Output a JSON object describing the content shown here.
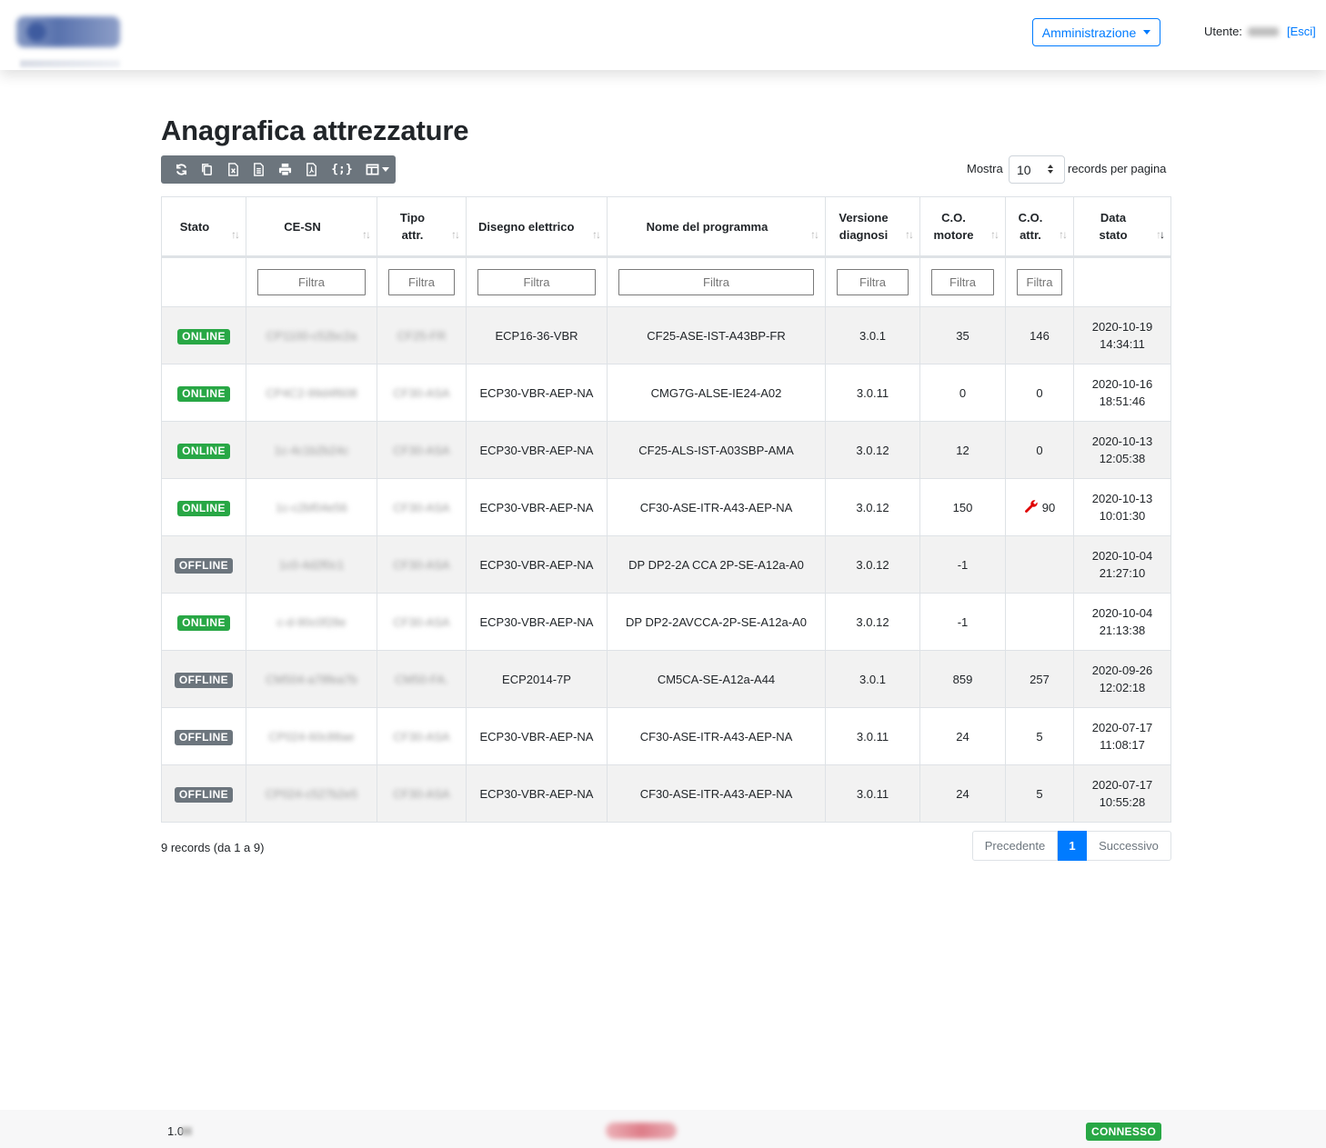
{
  "header": {
    "admin_menu": "Amministrazione",
    "user_label": "Utente:",
    "logout": "[Esci]"
  },
  "page": {
    "title": "Anagrafica attrezzature"
  },
  "toolbar": {
    "icons": [
      "refresh-icon",
      "copy-icon",
      "excel-icon",
      "csv-icon",
      "print-icon",
      "pdf-icon",
      "json-icon",
      "columns-icon"
    ],
    "json_label": "{;}"
  },
  "length": {
    "label_before": "Mostra",
    "value": "10",
    "label_after": "records per pagina"
  },
  "table": {
    "columns": [
      "Stato",
      "CE-SN",
      "Tipo attr.",
      "Disegno elettrico",
      "Nome del programma",
      "Versione diagnosi",
      "C.O. motore",
      "C.O. attr.",
      "Data stato"
    ],
    "filter_placeholder": "Filtra",
    "rows": [
      {
        "stato": "ONLINE",
        "cesn": "CP1100-c52bc2a",
        "tipo": "CF25-FR",
        "disegno": "ECP16-36-VBR",
        "programma": "CF25-ASE-IST-A43BP-FR",
        "versione": "3.0.1",
        "motore": "35",
        "attr": "146",
        "attr_wrench": false,
        "date": "2020-10-19",
        "time": "14:34:11"
      },
      {
        "stato": "ONLINE",
        "cesn": "CP4C2-99d4f608",
        "tipo": "CF30-ASA",
        "disegno": "ECP30-VBR-AEP-NA",
        "programma": "CMG7G-ALSE-IE24-A02",
        "versione": "3.0.11",
        "motore": "0",
        "attr": "0",
        "attr_wrench": false,
        "date": "2020-10-16",
        "time": "18:51:46"
      },
      {
        "stato": "ONLINE",
        "cesn": "1c-4c1b2b24c",
        "tipo": "CF30-ASA",
        "disegno": "ECP30-VBR-AEP-NA",
        "programma": "CF25-ALS-IST-A03SBP-AMA",
        "versione": "3.0.12",
        "motore": "12",
        "attr": "0",
        "attr_wrench": false,
        "date": "2020-10-13",
        "time": "12:05:38"
      },
      {
        "stato": "ONLINE",
        "cesn": "1c-c2bf04e56",
        "tipo": "CF30-ASA",
        "disegno": "ECP30-VBR-AEP-NA",
        "programma": "CF30-ASE-ITR-A43-AEP-NA",
        "versione": "3.0.12",
        "motore": "150",
        "attr": "90",
        "attr_wrench": true,
        "date": "2020-10-13",
        "time": "10:01:30"
      },
      {
        "stato": "OFFLINE",
        "cesn": "1c0-4d2f0c1",
        "tipo": "CF30-ASA",
        "disegno": "ECP30-VBR-AEP-NA",
        "programma": "DP DP2-2A CCA 2P-SE-A12a-A0",
        "versione": "3.0.12",
        "motore": "-1",
        "attr": "",
        "attr_wrench": false,
        "date": "2020-10-04",
        "time": "21:27:10"
      },
      {
        "stato": "ONLINE",
        "cesn": "c-d-90c0f28e",
        "tipo": "CF30-ASA",
        "disegno": "ECP30-VBR-AEP-NA",
        "programma": "DP DP2-2AVCCA-2P-SE-A12a-A0",
        "versione": "3.0.12",
        "motore": "-1",
        "attr": "",
        "attr_wrench": false,
        "date": "2020-10-04",
        "time": "21:13:38"
      },
      {
        "stato": "OFFLINE",
        "cesn": "CM504-a78fea7b",
        "tipo": "CM50-FA.",
        "disegno": "ECP2014-7P",
        "programma": "CM5CA-SE-A12a-A44",
        "versione": "3.0.1",
        "motore": "859",
        "attr": "257",
        "attr_wrench": false,
        "date": "2020-09-26",
        "time": "12:02:18"
      },
      {
        "stato": "OFFLINE",
        "cesn": "CP024-60c88ae",
        "tipo": "CF30-ASA",
        "disegno": "ECP30-VBR-AEP-NA",
        "programma": "CF30-ASE-ITR-A43-AEP-NA",
        "versione": "3.0.11",
        "motore": "24",
        "attr": "5",
        "attr_wrench": false,
        "date": "2020-07-17",
        "time": "11:08:17"
      },
      {
        "stato": "OFFLINE",
        "cesn": "CP024-c527b2e5",
        "tipo": "CF30-ASA",
        "disegno": "ECP30-VBR-AEP-NA",
        "programma": "CF30-ASE-ITR-A43-AEP-NA",
        "versione": "3.0.11",
        "motore": "24",
        "attr": "5",
        "attr_wrench": false,
        "date": "2020-07-17",
        "time": "10:55:28"
      }
    ]
  },
  "pagination": {
    "info": "9 records (da 1 a 9)",
    "prev": "Precedente",
    "current": "1",
    "next": "Successivo"
  },
  "footer": {
    "version": "1.0",
    "status": "CONNESSO"
  },
  "colors": {
    "online": "#28a745",
    "offline": "#6c757d",
    "accent": "#007bff",
    "wrench": "#e00000"
  }
}
